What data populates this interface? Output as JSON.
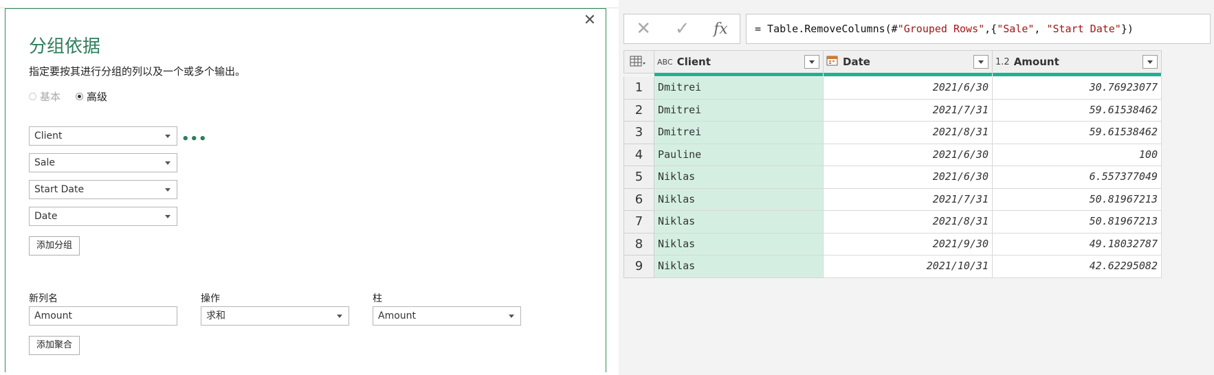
{
  "dialog": {
    "title": "分组依据",
    "subtitle": "指定要按其进行分组的列以及一个或多个输出。",
    "close_symbol": "✕",
    "radio_basic": "基本",
    "radio_advanced": "高级",
    "group_fields": [
      "Client",
      "Sale",
      "Start Date",
      "Date"
    ],
    "more_symbol": "•••",
    "add_group_button": "添加分组",
    "labels": {
      "new_column": "新列名",
      "operation": "操作",
      "column": "柱"
    },
    "new_column_value": "Amount",
    "operation_value": "求和",
    "column_value": "Amount",
    "add_aggregation_button": "添加聚合"
  },
  "formula": {
    "cancel_symbol": "✕",
    "confirm_symbol": "✓",
    "fx": "fx",
    "prefix": "= Table.RemoveColumns(#",
    "s1": "\"Grouped Rows\"",
    "mid": ",{",
    "s2": "\"Sale\"",
    "sep": ", ",
    "s3": "\"Start Date\"",
    "suffix": "})"
  },
  "table": {
    "columns": [
      {
        "type_icon": "ABC",
        "name": "Client"
      },
      {
        "type_icon": "calendar-icon",
        "name": "Date"
      },
      {
        "type_icon": "1.2",
        "name": "Amount"
      }
    ],
    "rows": [
      {
        "n": "1",
        "client": "Dmitrei",
        "date": "2021/6/30",
        "amount": "30.76923077"
      },
      {
        "n": "2",
        "client": "Dmitrei",
        "date": "2021/7/31",
        "amount": "59.61538462"
      },
      {
        "n": "3",
        "client": "Dmitrei",
        "date": "2021/8/31",
        "amount": "59.61538462"
      },
      {
        "n": "4",
        "client": "Pauline",
        "date": "2021/6/30",
        "amount": "100"
      },
      {
        "n": "5",
        "client": "Niklas",
        "date": "2021/6/30",
        "amount": "6.557377049"
      },
      {
        "n": "6",
        "client": "Niklas",
        "date": "2021/7/31",
        "amount": "50.81967213"
      },
      {
        "n": "7",
        "client": "Niklas",
        "date": "2021/8/31",
        "amount": "50.81967213"
      },
      {
        "n": "8",
        "client": "Niklas",
        "date": "2021/9/30",
        "amount": "49.18032787"
      },
      {
        "n": "9",
        "client": "Niklas",
        "date": "2021/10/31",
        "amount": "42.62295082"
      }
    ]
  },
  "colors": {
    "accent": "#2e7d5b",
    "column_bar": "#1ab394",
    "selected_column": "#d4efe2"
  }
}
